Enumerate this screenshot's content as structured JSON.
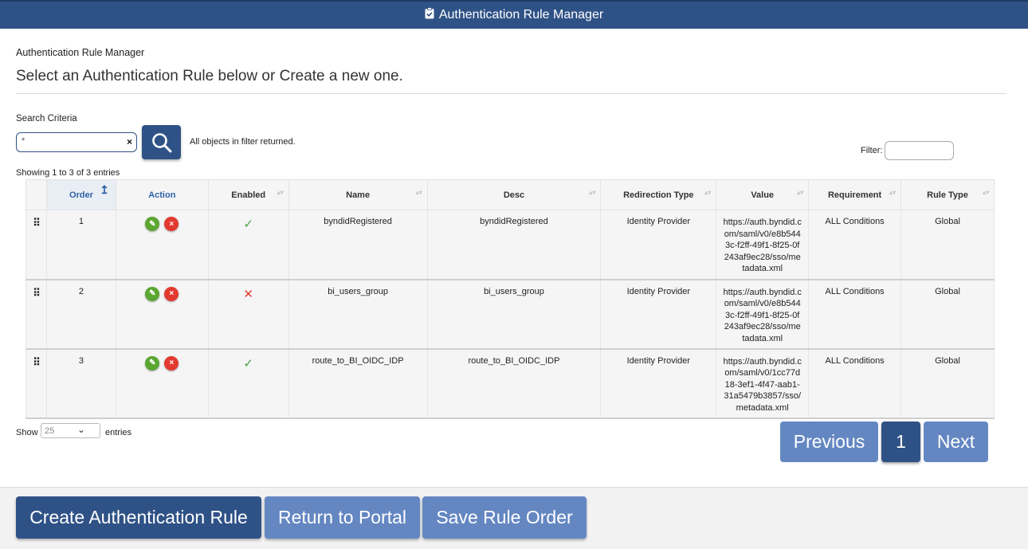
{
  "header": {
    "title": "Authentication Rule Manager",
    "icon": "clipboard-check-icon"
  },
  "breadcrumb": "Authentication Rule Manager",
  "headline": "Select an Authentication Rule below or Create a new one.",
  "search": {
    "label": "Search Criteria",
    "value": "*",
    "clear_glyph": "×",
    "message": "All objects in filter returned."
  },
  "filter": {
    "label": "Filter:",
    "value": ""
  },
  "showing": "Showing 1 to 3 of 3 entries",
  "table": {
    "columns": [
      "Order",
      "Action",
      "Enabled",
      "Name",
      "Desc",
      "Redirection Type",
      "Value",
      "Requirement",
      "Rule Type"
    ],
    "sort_up_glyph": "↥",
    "sort_glyph": "▴▾",
    "rows": [
      {
        "order": "1",
        "enabled": "✓",
        "name": "byndidRegistered",
        "desc": "byndidRegistered",
        "redirection": "Identity Provider",
        "value": "https://auth.byndid.com/saml/v0/e8b5443c-f2ff-49f1-8f25-0f243af9ec28/sso/metadata.xml",
        "requirement": "ALL Conditions",
        "rule_type": "Global"
      },
      {
        "order": "2",
        "enabled": "✕",
        "name": "bi_users_group",
        "desc": "bi_users_group",
        "redirection": "Identity Provider",
        "value": "https://auth.byndid.com/saml/v0/e8b5443c-f2ff-49f1-8f25-0f243af9ec28/sso/metadata.xml",
        "requirement": "ALL Conditions",
        "rule_type": "Global"
      },
      {
        "order": "3",
        "enabled": "✓",
        "name": "route_to_BI_OIDC_IDP",
        "desc": "route_to_BI_OIDC_IDP",
        "redirection": "Identity Provider",
        "value": "https://auth.byndid.com/saml/v0/1cc77d18-3ef1-4f47-aab1-31a5479b3857/sso/metadata.xml",
        "requirement": "ALL Conditions",
        "rule_type": "Global"
      }
    ],
    "edit_glyph": "✎",
    "delete_glyph": "×",
    "grip_glyph": "⠿"
  },
  "length": {
    "show_label": "Show",
    "value": "25",
    "entries_label": "entries"
  },
  "pagination": {
    "previous": "Previous",
    "page": "1",
    "next": "Next"
  },
  "footer": {
    "create": "Create Authentication Rule",
    "portal": "Return to Portal",
    "save": "Save Rule Order"
  },
  "colors": {
    "primary": "#2f5286",
    "secondary": "#6487c2",
    "success": "#45a045",
    "danger": "#e23a2f"
  }
}
